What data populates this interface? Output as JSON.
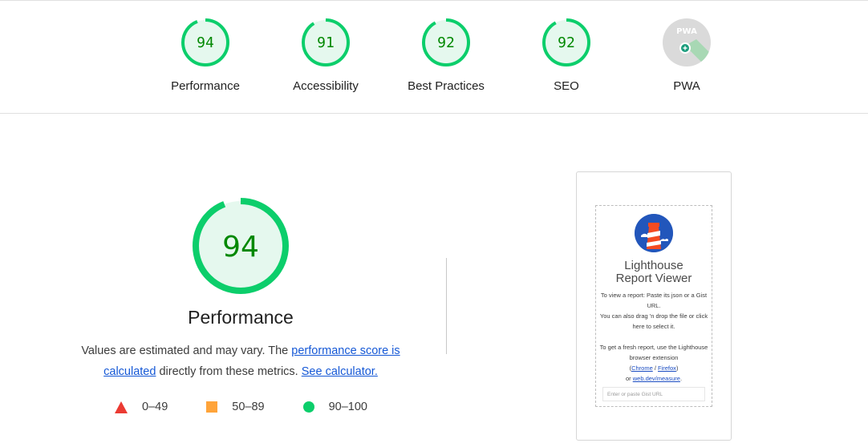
{
  "categories": [
    {
      "label": "Performance",
      "score": "94",
      "value": 94,
      "color": "#0cce6b",
      "text_color": "#008800"
    },
    {
      "label": "Accessibility",
      "score": "91",
      "value": 91,
      "color": "#0cce6b",
      "text_color": "#008800"
    },
    {
      "label": "Best Practices",
      "score": "92",
      "value": 92,
      "color": "#0cce6b",
      "text_color": "#008800"
    },
    {
      "label": "SEO",
      "score": "92",
      "value": 92,
      "color": "#0cce6b",
      "text_color": "#008800"
    }
  ],
  "pwa": {
    "label": "PWA",
    "badge": "PWA",
    "icon": "pwa-badge-icon"
  },
  "main": {
    "score": "94",
    "value": 94,
    "title": "Performance",
    "desc_prefix": "Values are estimated and may vary. The ",
    "desc_link1": "performance score is calculated",
    "desc_middle": " directly from these metrics. ",
    "desc_link2": "See calculator."
  },
  "legend": [
    {
      "range": "0–49",
      "shape": "triangle",
      "color": "#eb3a32"
    },
    {
      "range": "50–89",
      "shape": "square",
      "color": "#ffa43a"
    },
    {
      "range": "90–100",
      "shape": "circle",
      "color": "#0cce6b"
    }
  ],
  "viewer": {
    "title_line1": "Lighthouse",
    "title_line2": "Report Viewer",
    "p1": "To view a report: Paste its json or a Gist URL.",
    "p2": "You can also drag 'n drop the file or click here to select it.",
    "p3_prefix": "To get a fresh report, use the Lighthouse browser extension",
    "chrome": "Chrome",
    "slash": " / ",
    "firefox": "Firefox",
    "or": "or ",
    "webdev": "web.dev/measure",
    "period": ".",
    "gist_placeholder": "Enter or paste Gist URL"
  }
}
